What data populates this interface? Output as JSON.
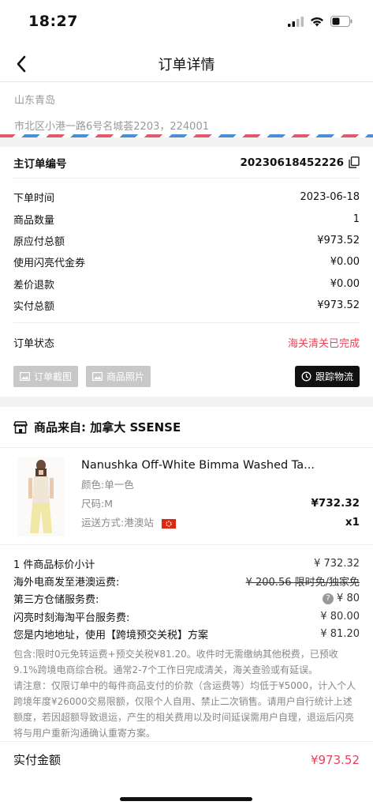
{
  "status_bar": {
    "time": "18:27"
  },
  "nav": {
    "title": "订单详情"
  },
  "address": {
    "region": "山东青岛",
    "detail": "市北区小港一路6号名城荟2203，224001"
  },
  "order": {
    "main_no_label": "主订单编号",
    "main_no_value": "20230618452226",
    "rows": [
      {
        "label": "下单时间",
        "value": "2023-06-18"
      },
      {
        "label": "商品数量",
        "value": "1"
      },
      {
        "label": "原应付总额",
        "value": "¥973.52"
      },
      {
        "label": "使用闪亮代金券",
        "value": "¥0.00"
      },
      {
        "label": "差价退款",
        "value": "¥0.00"
      },
      {
        "label": "实付总额",
        "value": "¥973.52"
      }
    ],
    "status_label": "订单状态",
    "status_value": "海关清关已完成",
    "btn_screenshot": "订单截图",
    "btn_photos": "商品照片",
    "btn_track": "跟踪物流"
  },
  "source": {
    "text": "商品来自: 加拿大 SSENSE"
  },
  "product": {
    "name": "Nanushka Off-White Bimma Washed Ta...",
    "color": "颜色:单一色",
    "size": "尺码:M",
    "price": "¥732.32",
    "shipping": "运送方式:港澳站",
    "qty": "x1"
  },
  "fees": {
    "subtotal_label": "1 件商品标价小计",
    "subtotal_value": "¥ 732.32",
    "overseas_label": "海外电商发至港澳运费:",
    "overseas_value": "¥ 200.56  限时免/独家免",
    "warehouse_label": "第三方仓储服务费:",
    "warehouse_value": "¥ 80",
    "platform_label": "闪亮时刻海淘平台服务费:",
    "platform_value": "¥ 80.00",
    "tax_label": "您是内地地址，使用【跨境预交关税】方案",
    "tax_value": "¥ 81.20",
    "note1": "包含:限时0元免转运费+预交关税¥81.20。收件时无需缴纳其他税费，已预收9.1%跨境电商综合税。通常2-7个工作日完成清关，海关查验或有延误。",
    "note2": "请注意：仅限订单中的每件商品支付的价款（含运费等）均低于¥5000，计入个人跨境年度¥26000交易限额，仅限个人自用、禁止二次销售。请用户自行统计上述额度，若因超额导致退运，产生的相关费用以及时间延误需用户自理，退运后闪亮将与用户重新沟通确认重寄方案。"
  },
  "total": {
    "label": "实付金额",
    "value": "¥973.52"
  },
  "colors": {
    "accent_red": "#e8415a",
    "button_gray": "#c8c8c8",
    "button_black": "#111111"
  }
}
